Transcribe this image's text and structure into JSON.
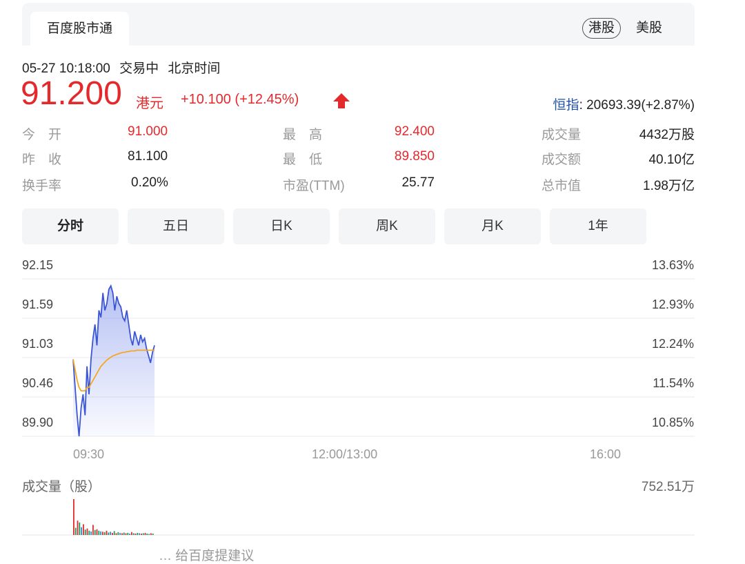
{
  "header": {
    "tab_label": "百度股市通",
    "market_hk": "港股",
    "market_us": "美股"
  },
  "status": {
    "datetime": "05-27 10:18:00",
    "trading": "交易中",
    "timezone": "北京时间"
  },
  "quote": {
    "price": "91.200",
    "currency": "港元",
    "change": "+10.100 (+12.45%)",
    "index_name": "恒指",
    "index_value": ": 20693.39(+2.87%)",
    "color_up": "#e4292c"
  },
  "stats": {
    "open_label": "今　开",
    "open": "91.000",
    "prev_close_label": "昨　收",
    "prev_close": "81.100",
    "turnover_rate_label": "换手率",
    "turnover_rate": "0.20%",
    "high_label": "最　高",
    "high": "92.400",
    "low_label": "最　低",
    "low": "89.850",
    "pe_label": "市盈(TTM)",
    "pe": "25.77",
    "volume_label": "成交量",
    "volume": "4432万股",
    "amount_label": "成交额",
    "amount": "40.10亿",
    "mktcap_label": "总市值",
    "mktcap": "1.98万亿"
  },
  "period_tabs": [
    "分时",
    "五日",
    "日K",
    "周K",
    "月K",
    "1年"
  ],
  "footer_partial": "… 给百度提建议",
  "chart_data": {
    "type": "line",
    "y_price_ticks": [
      "92.15",
      "91.59",
      "91.03",
      "90.46",
      "89.90"
    ],
    "y_pct_ticks": [
      "13.63%",
      "12.93%",
      "12.24%",
      "11.54%",
      "10.85%"
    ],
    "ylim": [
      89.9,
      92.15
    ],
    "x_ticks": [
      "09:30",
      "12:00/13:00",
      "16:00"
    ],
    "series": [
      {
        "color": "#3a55d6",
        "values": [
          91.0,
          90.6,
          90.2,
          89.9,
          90.3,
          90.5,
          90.2,
          90.9,
          90.5,
          91.0,
          91.3,
          91.5,
          91.2,
          91.7,
          91.6,
          91.95,
          91.7,
          91.8,
          92.0,
          92.05,
          91.95,
          91.7,
          91.9,
          91.8,
          91.75,
          91.6,
          91.55,
          91.7,
          91.5,
          91.3,
          91.2,
          91.4,
          91.3,
          91.2,
          91.35,
          91.25,
          91.3,
          91.15,
          91.05,
          90.95,
          91.1,
          91.2
        ]
      },
      {
        "color": "#f5a623",
        "values": [
          91.0,
          90.85,
          90.7,
          90.6,
          90.55,
          90.55,
          90.55,
          90.6,
          90.6,
          90.65,
          90.7,
          90.75,
          90.8,
          90.85,
          90.9,
          90.93,
          90.96,
          90.99,
          91.01,
          91.03,
          91.05,
          91.06,
          91.07,
          91.08,
          91.09,
          91.1,
          91.1,
          91.11,
          91.11,
          91.12,
          91.12,
          91.12,
          91.13,
          91.13,
          91.13,
          91.13,
          91.13,
          91.13,
          91.13,
          91.13,
          91.13,
          91.13
        ]
      }
    ],
    "volume_label": "成交量（股）",
    "volume_max": "752.51万",
    "volume_values": [
      100,
      20,
      40,
      35,
      22,
      30,
      15,
      18,
      12,
      10,
      28,
      14,
      16,
      12,
      10,
      9,
      8,
      12,
      7,
      9,
      6,
      11,
      5,
      8,
      6,
      5,
      7,
      5,
      6,
      4,
      8,
      5,
      4,
      6,
      5,
      4,
      5,
      6,
      4,
      3,
      5,
      4
    ]
  }
}
